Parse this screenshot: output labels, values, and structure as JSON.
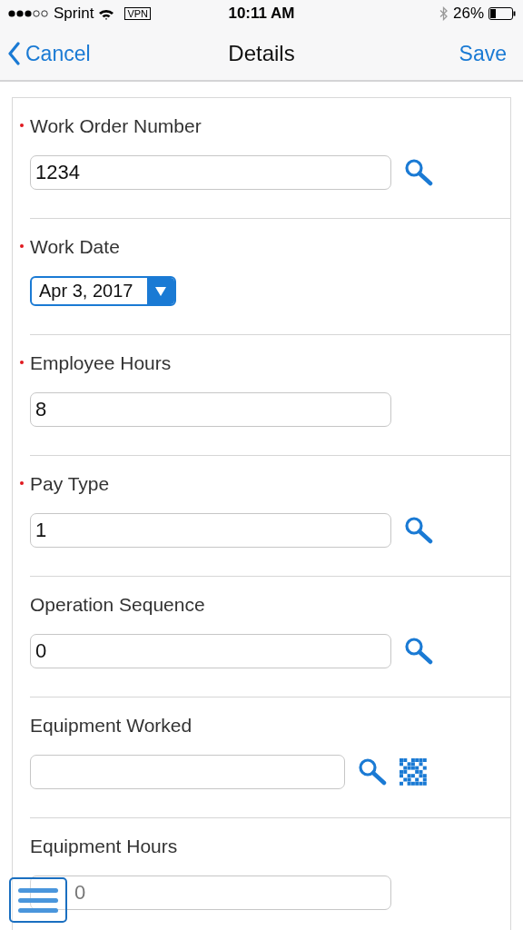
{
  "status_bar": {
    "carrier": "Sprint",
    "vpn": "VPN",
    "time": "10:11 AM",
    "battery": "26%"
  },
  "nav_bar": {
    "back": "Cancel",
    "title": "Details",
    "action": "Save"
  },
  "fields": [
    {
      "label": "Work Order Number",
      "required": true,
      "kind": "text",
      "value": "1234",
      "search": true
    },
    {
      "label": "Work Date",
      "required": true,
      "kind": "date",
      "value": "Apr 3, 2017"
    },
    {
      "label": "Employee Hours",
      "required": true,
      "kind": "text",
      "value": "8"
    },
    {
      "label": "Pay Type",
      "required": true,
      "kind": "text",
      "value": "1",
      "search": true
    },
    {
      "label": "Operation Sequence",
      "required": false,
      "kind": "text",
      "value": "0",
      "search": true
    },
    {
      "label": "Equipment Worked",
      "required": false,
      "kind": "text",
      "search": true,
      "barcode": true
    },
    {
      "label": "Equipment Hours",
      "required": false,
      "kind": "text",
      "placeholder": "0"
    }
  ]
}
